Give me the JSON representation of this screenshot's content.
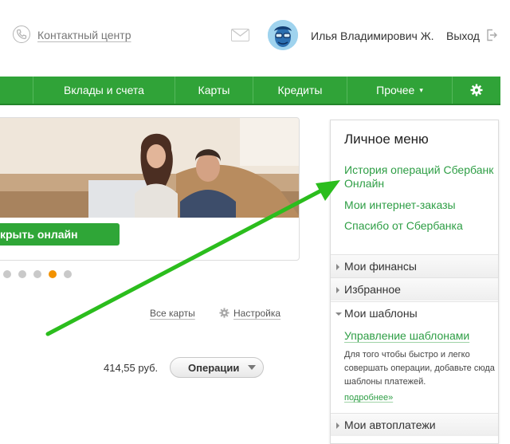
{
  "header": {
    "contact_center": "Контактный центр",
    "user_name": "Илья Владимирович Ж.",
    "logout": "Выход"
  },
  "nav": {
    "items": [
      {
        "label": ""
      },
      {
        "label": "Вклады и счета"
      },
      {
        "label": "Карты"
      },
      {
        "label": "Кредиты"
      },
      {
        "label": "Прочее"
      }
    ]
  },
  "banner": {
    "button_label": "крыть онлайн",
    "slides_total": 5,
    "active_slide": 4
  },
  "cards": {
    "all_cards": "Все карты",
    "settings": "Настройка",
    "balance": "414,55 руб.",
    "operations_button": "Операции"
  },
  "menu": {
    "title": "Личное меню",
    "links": [
      "История операций Сбербанк Онлайн",
      "Мои интернет-заказы",
      "Спасибо от Сбербанка"
    ],
    "sections": {
      "finances": "Мои финансы",
      "favorites": "Избранное",
      "templates": "Мои шаблоны",
      "autopayments": "Мои автоплатежи"
    },
    "templates_manage": "Управление шаблонами",
    "templates_description": "Для того чтобы быстро и легко совершать операции, добавьте сюда шаблоны платежей.",
    "more": "подробнее»"
  },
  "colors": {
    "brand_green": "#30a338",
    "link_green": "#2e9e45",
    "arrow_green": "#2bbd1d",
    "active_dot": "#f29200"
  }
}
